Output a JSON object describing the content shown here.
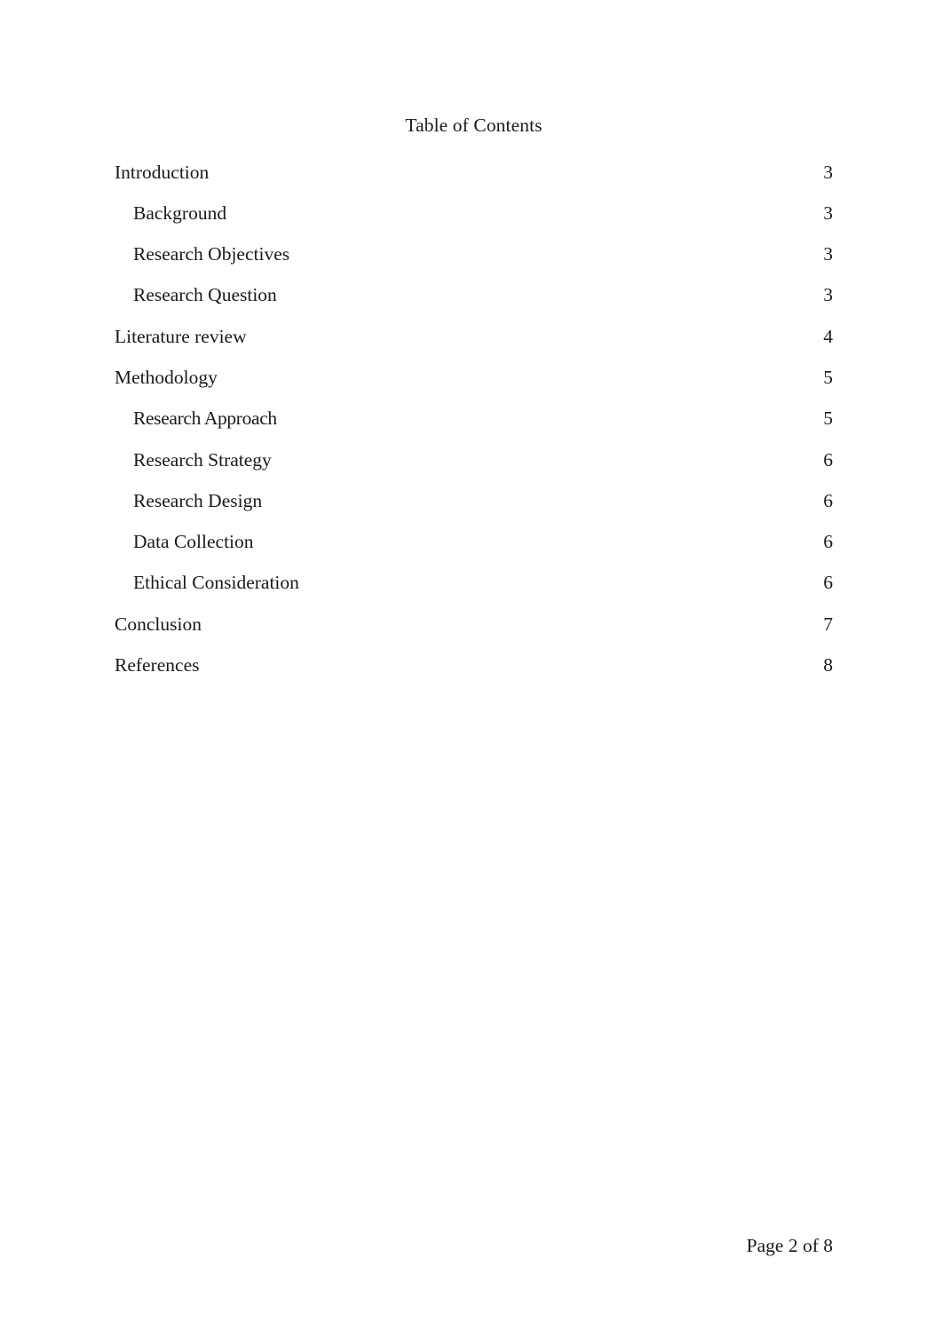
{
  "document": {
    "title": "Table of Contents",
    "footer": "Page 2 of 8"
  },
  "toc": {
    "entries": [
      {
        "label": "Introduction",
        "page": "3",
        "level": 1
      },
      {
        "label": "Background",
        "page": "3",
        "level": 2
      },
      {
        "label": "Research Objectives",
        "page": "3",
        "level": 2
      },
      {
        "label": "Research Question",
        "page": "3",
        "level": 2
      },
      {
        "label": "Literature review",
        "page": "4",
        "level": 1
      },
      {
        "label": "Methodology",
        "page": "5",
        "level": 1
      },
      {
        "label": "Research Approach",
        "page": "5",
        "level": 2
      },
      {
        "label": "Research Strategy",
        "page": "6",
        "level": 2
      },
      {
        "label": "Research Design",
        "page": "6",
        "level": 2
      },
      {
        "label": "Data Collection",
        "page": "6",
        "level": 2
      },
      {
        "label": "Ethical Consideration",
        "page": "6",
        "level": 2
      },
      {
        "label": "Conclusion",
        "page": "7",
        "level": 1
      },
      {
        "label": "References",
        "page": "8",
        "level": 1
      }
    ]
  },
  "colors": {
    "page_background": "#ffffff",
    "text": "#1a1a1a"
  }
}
